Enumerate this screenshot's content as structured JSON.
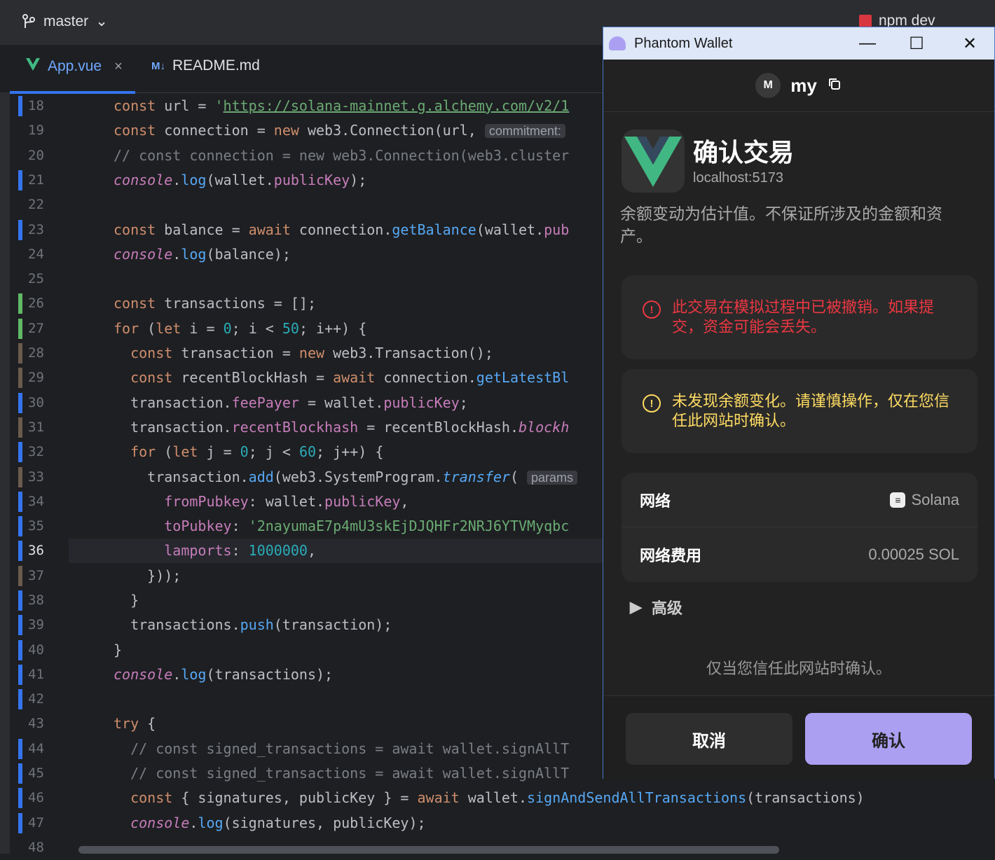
{
  "ide": {
    "branch": "master",
    "run_config": "npm dev",
    "tabs": [
      {
        "label": "App.vue",
        "close": "×"
      },
      {
        "label": "README.md",
        "badge": "M↓"
      }
    ],
    "current_line": 36
  },
  "code_lines": [
    {
      "n": 18,
      "segs": [
        [
          "k",
          "const "
        ],
        [
          "",
          "url = "
        ],
        [
          "s",
          "'"
        ],
        [
          "s u",
          "https://solana-mainnet.g.alchemy.com/v2/1"
        ]
      ]
    },
    {
      "n": 19,
      "segs": [
        [
          "k",
          "const "
        ],
        [
          "",
          "connection = "
        ],
        [
          "k",
          "new "
        ],
        [
          "",
          "web3.Connection(url, "
        ],
        [
          "hint",
          "commitment:"
        ]
      ]
    },
    {
      "n": 20,
      "segs": [
        [
          "c",
          "// const connection = new web3.Connection(web3.cluster"
        ]
      ]
    },
    {
      "n": 21,
      "segs": [
        [
          "p it",
          "console"
        ],
        [
          "",
          "."
        ],
        [
          "f",
          "log"
        ],
        [
          "",
          "(wallet."
        ],
        [
          "p",
          "publicKey"
        ],
        [
          "",
          ");"
        ]
      ]
    },
    {
      "n": 22,
      "segs": []
    },
    {
      "n": 23,
      "segs": [
        [
          "k",
          "const "
        ],
        [
          "",
          "balance = "
        ],
        [
          "k",
          "await "
        ],
        [
          "",
          "connection."
        ],
        [
          "f",
          "getBalance"
        ],
        [
          "",
          "(wallet."
        ],
        [
          "p",
          "pub"
        ]
      ]
    },
    {
      "n": 24,
      "segs": [
        [
          "p it",
          "console"
        ],
        [
          "",
          "."
        ],
        [
          "f",
          "log"
        ],
        [
          "",
          "(balance);"
        ]
      ]
    },
    {
      "n": 25,
      "segs": []
    },
    {
      "n": 26,
      "segs": [
        [
          "k",
          "const "
        ],
        [
          "",
          "transactions = [];"
        ]
      ]
    },
    {
      "n": 27,
      "segs": [
        [
          "k",
          "for "
        ],
        [
          "",
          "("
        ],
        [
          "k",
          "let "
        ],
        [
          "",
          "i = "
        ],
        [
          "n",
          "0"
        ],
        [
          "",
          "; i < "
        ],
        [
          "n",
          "50"
        ],
        [
          "",
          "; i++) {"
        ]
      ]
    },
    {
      "n": 28,
      "segs": [
        [
          "",
          "  "
        ],
        [
          "k",
          "const "
        ],
        [
          "",
          "transaction = "
        ],
        [
          "k",
          "new "
        ],
        [
          "",
          "web3.Transaction();"
        ]
      ]
    },
    {
      "n": 29,
      "segs": [
        [
          "",
          "  "
        ],
        [
          "k",
          "const "
        ],
        [
          "",
          "recentBlockHash = "
        ],
        [
          "k",
          "await "
        ],
        [
          "",
          "connection."
        ],
        [
          "f",
          "getLatestBl"
        ]
      ]
    },
    {
      "n": 30,
      "segs": [
        [
          "",
          "  transaction."
        ],
        [
          "p",
          "feePayer"
        ],
        [
          "",
          " = wallet."
        ],
        [
          "p",
          "publicKey"
        ],
        [
          "",
          ";"
        ]
      ]
    },
    {
      "n": 31,
      "segs": [
        [
          "",
          "  transaction."
        ],
        [
          "p",
          "recentBlockhash"
        ],
        [
          "",
          " = recentBlockHash."
        ],
        [
          "p it",
          "blockh"
        ]
      ]
    },
    {
      "n": 32,
      "segs": [
        [
          "",
          "  "
        ],
        [
          "k",
          "for "
        ],
        [
          "",
          "("
        ],
        [
          "k",
          "let "
        ],
        [
          "",
          "j = "
        ],
        [
          "n",
          "0"
        ],
        [
          "",
          "; j < "
        ],
        [
          "n",
          "60"
        ],
        [
          "",
          "; j++) {"
        ]
      ]
    },
    {
      "n": 33,
      "segs": [
        [
          "",
          "    transaction."
        ],
        [
          "f",
          "add"
        ],
        [
          "",
          "(web3.SystemProgram."
        ],
        [
          "f it",
          "transfer"
        ],
        [
          "",
          "( "
        ],
        [
          "hint",
          "params"
        ]
      ]
    },
    {
      "n": 34,
      "segs": [
        [
          "",
          "      "
        ],
        [
          "p",
          "fromPubkey"
        ],
        [
          "",
          ": wallet."
        ],
        [
          "p",
          "publicKey"
        ],
        [
          "",
          ","
        ]
      ]
    },
    {
      "n": 35,
      "segs": [
        [
          "",
          "      "
        ],
        [
          "p",
          "toPubkey"
        ],
        [
          "",
          ": "
        ],
        [
          "s",
          "'2nayumaE7p4mU3skEjDJQHFr2NRJ6YTVMyqbc"
        ]
      ]
    },
    {
      "n": 36,
      "segs": [
        [
          "",
          "      "
        ],
        [
          "p",
          "lamports"
        ],
        [
          "",
          ": "
        ],
        [
          "n",
          "1000000"
        ],
        [
          "",
          ","
        ]
      ]
    },
    {
      "n": 37,
      "segs": [
        [
          "",
          "    }));"
        ]
      ]
    },
    {
      "n": 38,
      "segs": [
        [
          "",
          "  }"
        ]
      ]
    },
    {
      "n": 39,
      "segs": [
        [
          "",
          "  transactions."
        ],
        [
          "f",
          "push"
        ],
        [
          "",
          "(transaction);"
        ]
      ]
    },
    {
      "n": 40,
      "segs": [
        [
          "",
          "}"
        ]
      ]
    },
    {
      "n": 41,
      "segs": [
        [
          "p it",
          "console"
        ],
        [
          "",
          "."
        ],
        [
          "f",
          "log"
        ],
        [
          "",
          "(transactions);"
        ]
      ]
    },
    {
      "n": 42,
      "segs": []
    },
    {
      "n": 43,
      "segs": [
        [
          "k",
          "try "
        ],
        [
          "",
          "{"
        ]
      ]
    },
    {
      "n": 44,
      "segs": [
        [
          "c",
          "  // const signed_transactions = await wallet.signAllT"
        ]
      ]
    },
    {
      "n": 45,
      "segs": [
        [
          "c",
          "  // const signed_transactions = await wallet.signAllT"
        ]
      ]
    },
    {
      "n": 46,
      "segs": [
        [
          "",
          "  "
        ],
        [
          "k",
          "const "
        ],
        [
          "",
          "{ signatures, publicKey } = "
        ],
        [
          "k",
          "await "
        ],
        [
          "",
          "wallet."
        ],
        [
          "f",
          "signAndSendAllTransactions"
        ],
        [
          "",
          "(transactions)"
        ]
      ]
    },
    {
      "n": 47,
      "segs": [
        [
          "",
          "  "
        ],
        [
          "p it",
          "console"
        ],
        [
          "",
          "."
        ],
        [
          "f",
          "log"
        ],
        [
          "",
          "(signatures, publicKey);"
        ]
      ]
    },
    {
      "n": 48,
      "segs": []
    }
  ],
  "gutter_marks": {
    "18": "#3574f0",
    "21": "#3574f0",
    "23": "#3574f0",
    "26": "#5fb865",
    "27": "#5fb865",
    "28": "#6b5b4e",
    "29": "#6b5b4e",
    "30": "#3574f0",
    "31": "#6b5b4e",
    "32": "#3574f0",
    "33": "#6b5b4e",
    "34": "#3574f0",
    "35": "#3574f0",
    "36": "#3574f0",
    "37": "#6b5b4e",
    "38": "#3574f0",
    "39": "#3574f0",
    "40": "#3574f0",
    "41": "#3574f0",
    "42": "#3574f0",
    "44": "#3574f0",
    "45": "#3574f0",
    "46": "#3574f0",
    "47": "#3574f0"
  },
  "phantom": {
    "window_title": "Phantom Wallet",
    "controls": {
      "minimize": "—",
      "maximize": "☐",
      "close": "✕"
    },
    "account_initial": "M",
    "account_name": "my",
    "title": "确认交易",
    "host": "localhost:5173",
    "description": "余额变动为估计值。不保证所涉及的金额和资产。",
    "error_text": "此交易在模拟过程中已被撤销。如果提交，资金可能会丢失。",
    "warning_text": "未发现余额变化。请谨慎操作，仅在您信任此网站时确认。",
    "network_label": "网络",
    "network_value": "Solana",
    "fee_label": "网络费用",
    "fee_value": "0.00025 SOL",
    "advanced": "高级",
    "note": "仅当您信任此网站时确认。",
    "cancel": "取消",
    "confirm": "确认",
    "colors": {
      "error": "#eb3742",
      "warning": "#ffdc62",
      "accent": "#ab9ff2"
    }
  }
}
